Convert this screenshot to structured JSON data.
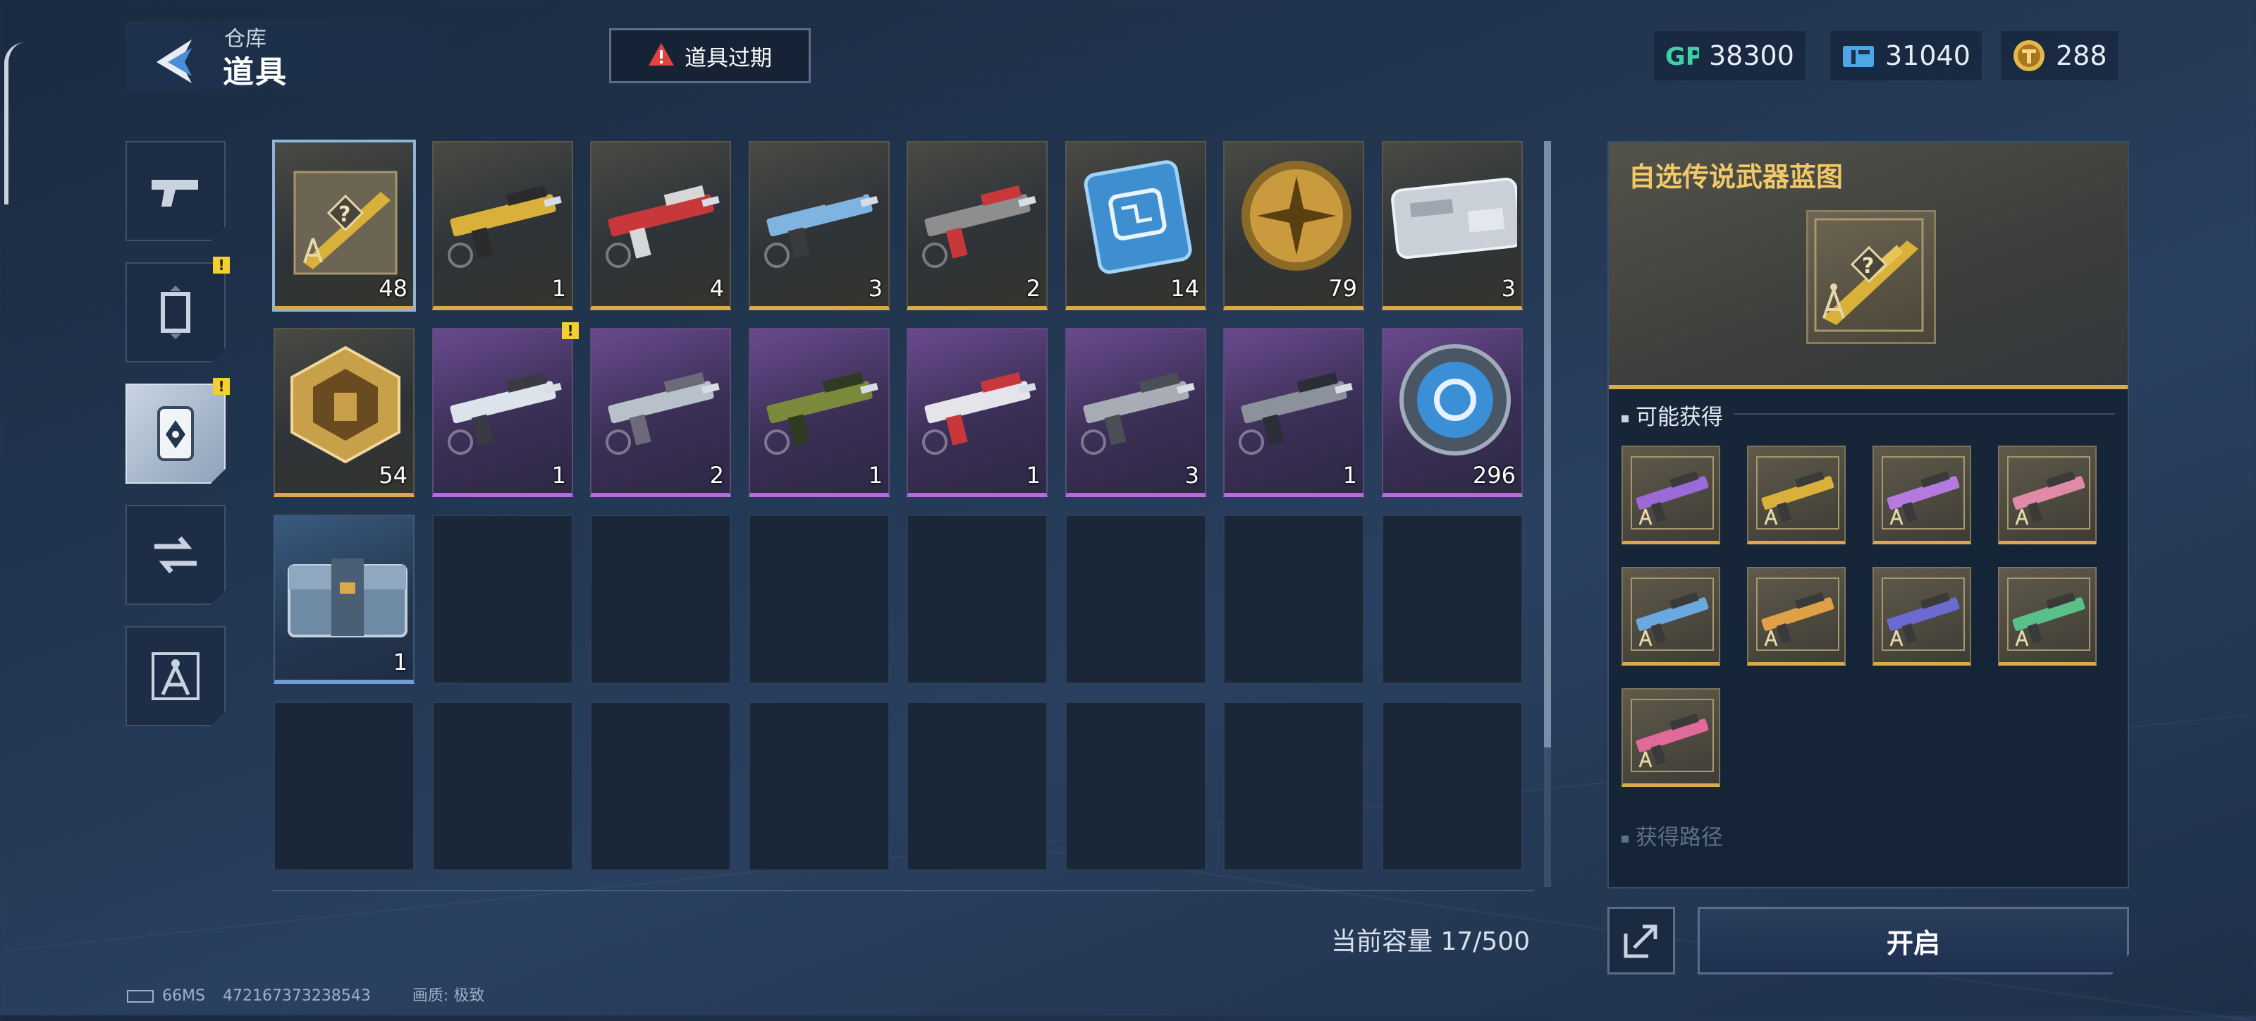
{
  "header": {
    "subtitle": "仓库",
    "title": "道具",
    "expire_button": "道具过期"
  },
  "currency": [
    {
      "icon": "gp-icon",
      "value": "38300",
      "color": "#3fd0a8"
    },
    {
      "icon": "ticket-icon",
      "value": "31040",
      "color": "#4ea6e6"
    },
    {
      "icon": "gold-coin-icon",
      "value": "288",
      "color": "#e6b84a"
    }
  ],
  "categories": [
    {
      "name": "weapons",
      "icon": "pistol-icon",
      "badge": ""
    },
    {
      "name": "frames",
      "icon": "frame-icon",
      "badge": "!"
    },
    {
      "name": "items",
      "icon": "item-card-icon",
      "badge": "!",
      "active": true
    },
    {
      "name": "mods",
      "icon": "exchange-icon",
      "badge": ""
    },
    {
      "name": "blueprints",
      "icon": "compass-icon",
      "badge": ""
    }
  ],
  "grid": {
    "rows": [
      [
        {
          "rarity": "gold",
          "icon": "blueprint-selectable-weapon-icon",
          "qty": "48",
          "selected": true
        },
        {
          "rarity": "gold",
          "icon": "gold-rifle-icon",
          "qty": "1"
        },
        {
          "rarity": "gold",
          "icon": "red-rifle-icon",
          "qty": "4"
        },
        {
          "rarity": "gold",
          "icon": "blue-pistol-icon",
          "qty": "3"
        },
        {
          "rarity": "gold",
          "icon": "red-smg-icon",
          "qty": "2"
        },
        {
          "rarity": "gold",
          "icon": "circuit-chip-icon",
          "qty": "14"
        },
        {
          "rarity": "gold",
          "icon": "gold-medal-icon",
          "qty": "79"
        },
        {
          "rarity": "gold",
          "icon": "silver-card-icon",
          "qty": "3"
        }
      ],
      [
        {
          "rarity": "gold",
          "icon": "gold-hexagon-badge-icon",
          "qty": "54"
        },
        {
          "rarity": "purple",
          "icon": "white-rifle-icon",
          "qty": "1",
          "badge": "!"
        },
        {
          "rarity": "purple",
          "icon": "silver-launcher-icon",
          "qty": "2"
        },
        {
          "rarity": "purple",
          "icon": "camo-rifle-icon",
          "qty": "1"
        },
        {
          "rarity": "purple",
          "icon": "red-white-rifle-icon",
          "qty": "1"
        },
        {
          "rarity": "purple",
          "icon": "grey-rifle-icon",
          "qty": "3"
        },
        {
          "rarity": "purple",
          "icon": "dark-pistol-icon",
          "qty": "1"
        },
        {
          "rarity": "purple",
          "icon": "blue-orb-token-icon",
          "qty": "296"
        }
      ],
      [
        {
          "rarity": "blue",
          "icon": "supply-crate-icon",
          "qty": "1"
        },
        {},
        {},
        {},
        {},
        {},
        {},
        {}
      ],
      [
        {},
        {},
        {},
        {},
        {},
        {},
        {},
        {}
      ]
    ]
  },
  "capacity": "当前容量 17/500",
  "detail": {
    "title": "自选传说武器蓝图",
    "possible_title": "可能获得",
    "possible_items": [
      {
        "icon": "purple-rifle-blueprint-icon",
        "tint": "#9a6ad6"
      },
      {
        "icon": "gold-rifle-blueprint-icon",
        "tint": "#d9b03a"
      },
      {
        "icon": "violet-smg-blueprint-icon",
        "tint": "#b47ae0"
      },
      {
        "icon": "pink-rifle-blueprint-icon",
        "tint": "#e08aa8"
      },
      {
        "icon": "blue-pistol-blueprint-icon",
        "tint": "#6aa8e0"
      },
      {
        "icon": "orange-rifle-blueprint-icon",
        "tint": "#e0a048"
      },
      {
        "icon": "navy-rifle-blueprint-icon",
        "tint": "#6a6ad0"
      },
      {
        "icon": "green-rifle-blueprint-icon",
        "tint": "#5ac08a"
      },
      {
        "icon": "pink-launcher-blueprint-icon",
        "tint": "#e06a98"
      }
    ],
    "source_title": "获得路径",
    "open_button": "开启"
  },
  "footer": {
    "ping": "66MS",
    "player_id": "472167373238543",
    "quality": "画质:  极致"
  }
}
